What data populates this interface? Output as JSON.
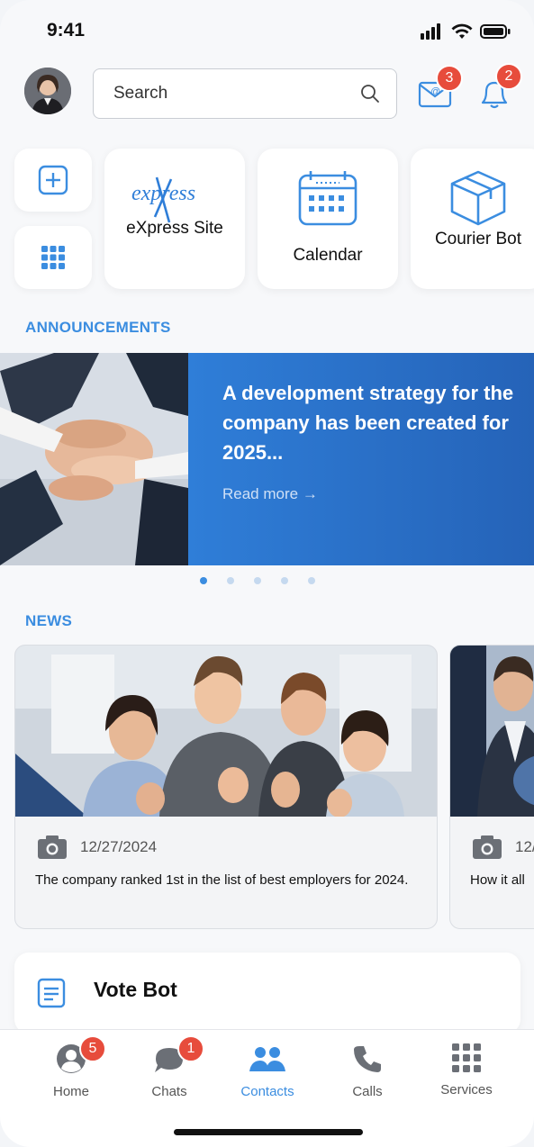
{
  "status": {
    "time": "9:41"
  },
  "search": {
    "placeholder": "Search"
  },
  "header": {
    "mail_badge": "3",
    "bell_badge": "2"
  },
  "apps": [
    {
      "label": "eXpress Site",
      "logo_text": "express"
    },
    {
      "label": "Calendar"
    },
    {
      "label": "Courier Bot"
    }
  ],
  "announcements": {
    "title": "ANNOUNCEMENTS",
    "headline": "A development strategy for the company has been created for 2025...",
    "read_more": "Read more  →"
  },
  "news": {
    "title": "NEWS",
    "items": [
      {
        "date": "12/27/2024",
        "text": "The company ranked 1st in the list of best employers for 2024."
      },
      {
        "date": "12/",
        "text": "How it all"
      }
    ]
  },
  "vote_bot": {
    "label": "Vote Bot"
  },
  "tabs": [
    {
      "label": "Home",
      "badge": "5"
    },
    {
      "label": "Chats",
      "badge": "1"
    },
    {
      "label": "Contacts"
    },
    {
      "label": "Calls"
    },
    {
      "label": "Services"
    }
  ],
  "colors": {
    "accent": "#3b8de0",
    "badge": "#e74c3c",
    "banner": "#2f7ed8"
  }
}
